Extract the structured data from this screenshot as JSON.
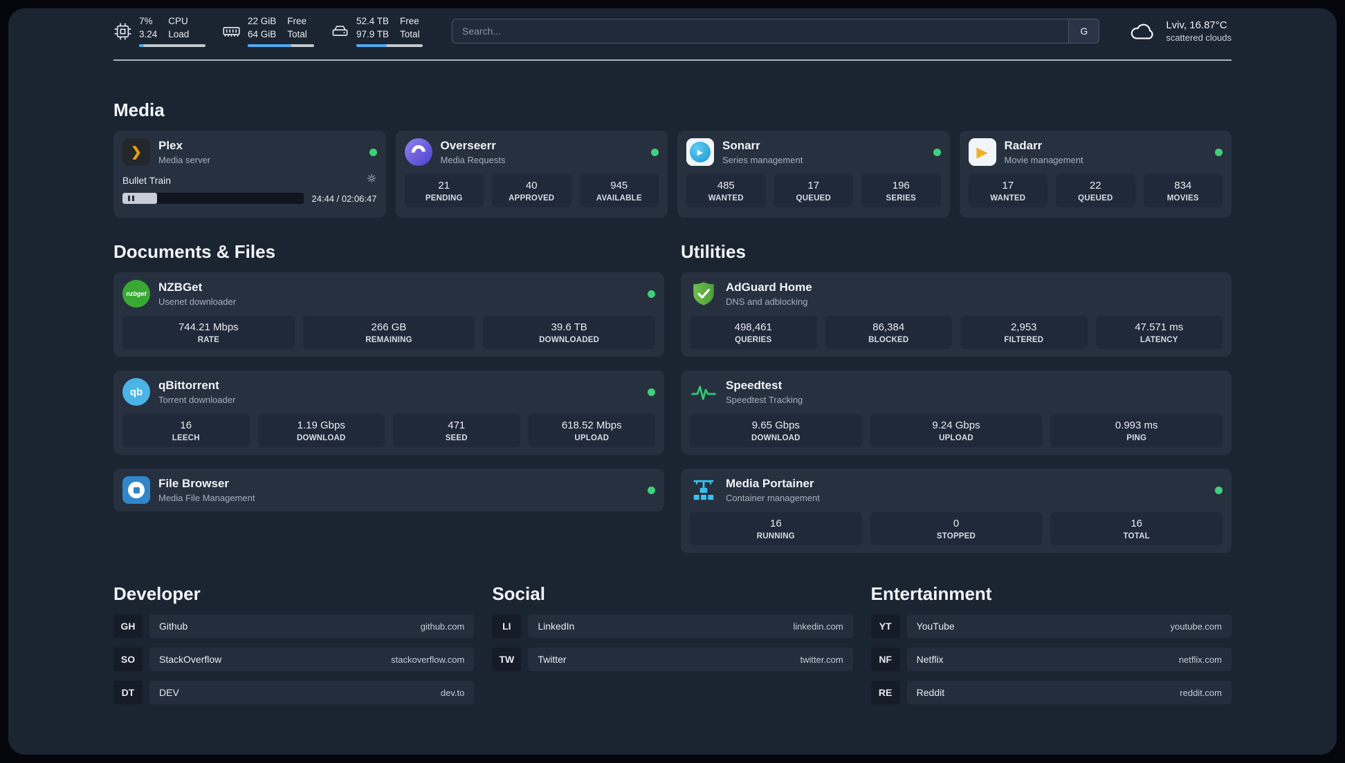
{
  "colors": {
    "background": "#1B2431",
    "card": "#27303F",
    "tile": "#202939",
    "status_online": "#3ED17A",
    "accent_blue": "#4DABF7"
  },
  "header": {
    "metrics": [
      {
        "icon": "cpu-icon",
        "value_top": "7%",
        "value_bottom": "3.24",
        "label_top": "CPU",
        "label_bottom": "Load",
        "bar_percent": "7%"
      },
      {
        "icon": "ram-icon",
        "value_top": "22 GiB",
        "value_bottom": "64 GiB",
        "label_top": "Free",
        "label_bottom": "Total",
        "bar_percent": "66%"
      },
      {
        "icon": "disk-icon",
        "value_top": "52.4 TB",
        "value_bottom": "97.9 TB",
        "label_top": "Free",
        "label_bottom": "Total",
        "bar_percent": "46%"
      }
    ],
    "search": {
      "placeholder": "Search...",
      "engine_label": "G"
    },
    "weather": {
      "icon": "cloud-icon",
      "location": "Lviv, 16.87°C",
      "condition": "scattered clouds"
    }
  },
  "sections": {
    "media": {
      "title": "Media",
      "cards": [
        {
          "icon": "plex-icon",
          "name": "Plex",
          "subtitle": "Media server",
          "status": "online",
          "player": {
            "track_title": "Bullet Train",
            "time": "24:44 / 02:06:47",
            "progress_percent": "19%"
          }
        },
        {
          "icon": "overseerr-icon",
          "name": "Overseerr",
          "subtitle": "Media Requests",
          "status": "online",
          "stats": [
            {
              "value": "21",
              "label": "PENDING"
            },
            {
              "value": "40",
              "label": "APPROVED"
            },
            {
              "value": "945",
              "label": "AVAILABLE"
            }
          ]
        },
        {
          "icon": "sonarr-icon",
          "name": "Sonarr",
          "subtitle": "Series management",
          "status": "online",
          "stats": [
            {
              "value": "485",
              "label": "WANTED"
            },
            {
              "value": "17",
              "label": "QUEUED"
            },
            {
              "value": "196",
              "label": "SERIES"
            }
          ]
        },
        {
          "icon": "radarr-icon",
          "name": "Radarr",
          "subtitle": "Movie management",
          "status": "online",
          "stats": [
            {
              "value": "17",
              "label": "WANTED"
            },
            {
              "value": "22",
              "label": "QUEUED"
            },
            {
              "value": "834",
              "label": "MOVIES"
            }
          ]
        }
      ]
    },
    "documents": {
      "title": "Documents & Files",
      "cards": [
        {
          "icon": "nzbget-icon",
          "icon_text": "nzbget",
          "name": "NZBGet",
          "subtitle": "Usenet downloader",
          "status": "online",
          "stats": [
            {
              "value": "744.21 Mbps",
              "label": "RATE"
            },
            {
              "value": "266 GB",
              "label": "REMAINING"
            },
            {
              "value": "39.6 TB",
              "label": "DOWNLOADED"
            }
          ]
        },
        {
          "icon": "qbittorrent-icon",
          "icon_text": "qb",
          "name": "qBittorrent",
          "subtitle": "Torrent downloader",
          "status": "online",
          "stats": [
            {
              "value": "16",
              "label": "LEECH"
            },
            {
              "value": "1.19 Gbps",
              "label": "DOWNLOAD"
            },
            {
              "value": "471",
              "label": "SEED"
            },
            {
              "value": "618.52 Mbps",
              "label": "UPLOAD"
            }
          ]
        },
        {
          "icon": "filebrowser-icon",
          "name": "File Browser",
          "subtitle": "Media File Management",
          "status": "online"
        }
      ]
    },
    "utilities": {
      "title": "Utilities",
      "cards": [
        {
          "icon": "adguard-icon",
          "name": "AdGuard Home",
          "subtitle": "DNS and adblocking",
          "stats": [
            {
              "value": "498,461",
              "label": "QUERIES"
            },
            {
              "value": "86,384",
              "label": "BLOCKED"
            },
            {
              "value": "2,953",
              "label": "FILTERED"
            },
            {
              "value": "47.571 ms",
              "label": "LATENCY"
            }
          ]
        },
        {
          "icon": "speedtest-icon",
          "name": "Speedtest",
          "subtitle": "Speedtest Tracking",
          "stats": [
            {
              "value": "9.65 Gbps",
              "label": "DOWNLOAD"
            },
            {
              "value": "9.24 Gbps",
              "label": "UPLOAD"
            },
            {
              "value": "0.993 ms",
              "label": "PING"
            }
          ]
        },
        {
          "icon": "portainer-icon",
          "name": "Media Portainer",
          "subtitle": "Container management",
          "status": "online",
          "stats": [
            {
              "value": "16",
              "label": "RUNNING"
            },
            {
              "value": "0",
              "label": "STOPPED"
            },
            {
              "value": "16",
              "label": "TOTAL"
            }
          ]
        }
      ]
    },
    "bookmarks": [
      {
        "title": "Developer",
        "links": [
          {
            "abbr": "GH",
            "name": "Github",
            "url": "github.com"
          },
          {
            "abbr": "SO",
            "name": "StackOverflow",
            "url": "stackoverflow.com"
          },
          {
            "abbr": "DT",
            "name": "DEV",
            "url": "dev.to"
          }
        ]
      },
      {
        "title": "Social",
        "links": [
          {
            "abbr": "LI",
            "name": "LinkedIn",
            "url": "linkedin.com"
          },
          {
            "abbr": "TW",
            "name": "Twitter",
            "url": "twitter.com"
          }
        ]
      },
      {
        "title": "Entertainment",
        "links": [
          {
            "abbr": "YT",
            "name": "YouTube",
            "url": "youtube.com"
          },
          {
            "abbr": "NF",
            "name": "Netflix",
            "url": "netflix.com"
          },
          {
            "abbr": "RE",
            "name": "Reddit",
            "url": "reddit.com"
          }
        ]
      }
    ]
  }
}
